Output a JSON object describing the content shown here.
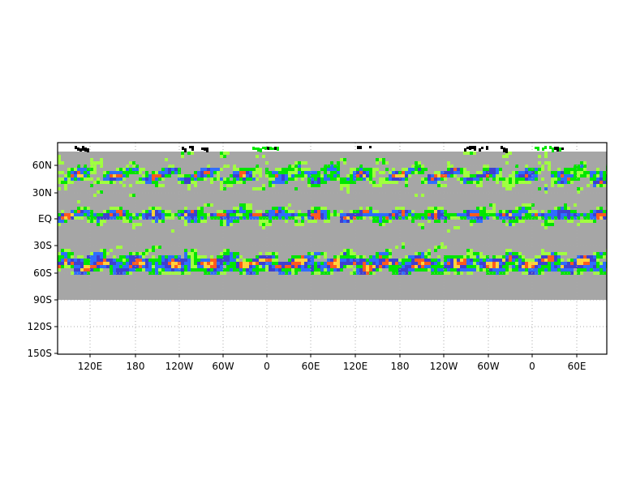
{
  "map": {
    "y_labels": [
      "60N",
      "30N",
      "EQ",
      "30S",
      "60S",
      "90S",
      "120S",
      "150S"
    ],
    "x_labels": [
      "120E",
      "180",
      "120W",
      "60W",
      "0",
      "60E",
      "120E",
      "180",
      "120W",
      "60W",
      "0",
      "60E"
    ],
    "colors": {
      "missing": "#a6a6a6",
      "level_low": "#00e600",
      "level_mid_low": "#a0ff40",
      "level_mid": "#2f6dff",
      "level_mid_high": "#3f3fd0",
      "level_high": "#ff5a1e",
      "level_peak": "#ffd23c",
      "grid": "#a8a8a8",
      "frame": "#000000"
    }
  }
}
